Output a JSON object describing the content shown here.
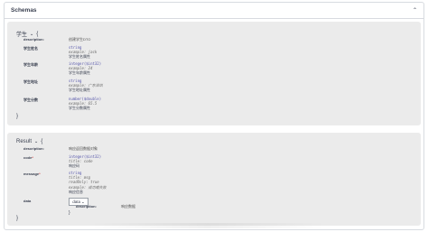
{
  "schemas": {
    "title": "Schemas",
    "toggle_icon": "chevron-up-icon"
  },
  "student_model": {
    "name": "学生",
    "toggle_icon": "chevron-down-icon",
    "open_brace": "{",
    "close_brace": "}",
    "description_key": "description:",
    "description_value": "创建学生DTO",
    "properties": [
      {
        "name": "学生姓名",
        "type": "string",
        "example": "example: jack",
        "label": "学生姓名属性"
      },
      {
        "name": "学生年龄",
        "type": "integer($int32)",
        "example": "example: 24",
        "label": "学生年龄属性"
      },
      {
        "name": "学生地址",
        "type": "string",
        "example": "example: 广东深圳",
        "label": "学生地址属性"
      },
      {
        "name": "学生分数",
        "type": "number($double)",
        "example": "example: 65.5",
        "label": "学生分数属性"
      }
    ]
  },
  "result_model": {
    "name": "Result",
    "toggle_icon": "chevron-down-icon",
    "open_brace": "{",
    "close_brace": "}",
    "description_key": "description:",
    "description_value": "响应返回数据对象",
    "properties": [
      {
        "name": "code",
        "required": "*",
        "lines": [
          "integer($int32)",
          "title: code"
        ],
        "label": "响应码"
      },
      {
        "name": "message",
        "required": "*",
        "lines": [
          "string",
          "title: msg",
          "readOnly: true",
          "example: 成功或失败"
        ],
        "label": "响应信息"
      }
    ],
    "data_prop": {
      "name": "data",
      "box_label": "data",
      "toggle_icon": "chevron-down-icon",
      "description_key": "description:",
      "description_value": "响应数据",
      "close_brace": "}"
    }
  }
}
